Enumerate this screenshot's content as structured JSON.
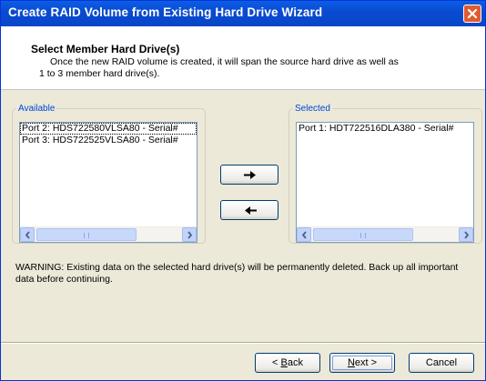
{
  "window": {
    "title": "Create RAID Volume from Existing Hard Drive Wizard",
    "close_icon": "close-icon"
  },
  "header": {
    "title": "Select Member Hard Drive(s)",
    "description_line1": "Once the new RAID volume is created, it will span the source hard drive as well as",
    "description_line2": "1 to 3 member hard drive(s)."
  },
  "available": {
    "label": "Available",
    "items": [
      "Port 2: HDS722580VLSA80 - Serial#",
      "Port 3: HDS722525VLSA80 - Serial#"
    ]
  },
  "selected": {
    "label": "Selected",
    "items": [
      "Port 1: HDT722516DLA380 - Serial#"
    ]
  },
  "transfer": {
    "add_icon": "arrow-right-icon",
    "remove_icon": "arrow-left-icon"
  },
  "warning": "WARNING: Existing data on the selected hard drive(s) will be permanently deleted. Back up all important data before continuing.",
  "buttons": {
    "back_prefix": "< ",
    "back_mnemonic": "B",
    "back_rest": "ack",
    "next_mnemonic": "N",
    "next_rest": "ext >",
    "cancel": "Cancel"
  },
  "colors": {
    "titlebar": "#0a5fe6",
    "close": "#e25a30",
    "legend": "#0046d5",
    "dialog_bg": "#ece9d8"
  }
}
